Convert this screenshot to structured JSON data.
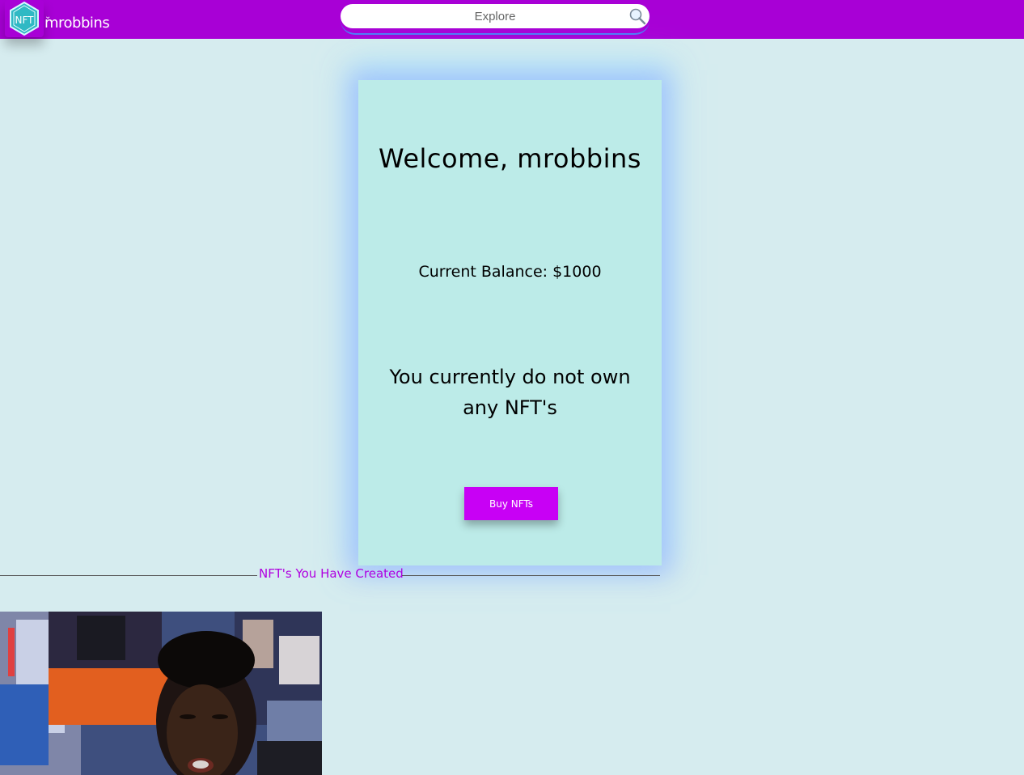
{
  "header": {
    "username": "mrobbins",
    "logo_text": "NFT",
    "search_placeholder": "Explore"
  },
  "profile_card": {
    "welcome": "Welcome, mrobbins",
    "balance": "Current Balance: $1000",
    "no_nfts_message": "You currently do not own any NFT's",
    "buy_button_label": "Buy NFTs"
  },
  "created_section": {
    "title": "NFT's You Have Created"
  },
  "colors": {
    "header_bg": "#a800d6",
    "page_bg": "#d6ecef",
    "card_bg": "#bcebe8",
    "button_bg": "#c800f5",
    "section_title": "#b000e0"
  }
}
